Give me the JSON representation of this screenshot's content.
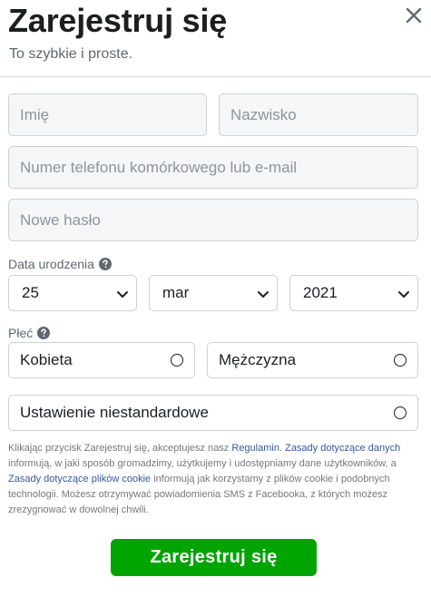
{
  "header": {
    "title": "Zarejestruj się",
    "subtitle": "To szybkie i proste."
  },
  "form": {
    "first_name_placeholder": "Imię",
    "last_name_placeholder": "Nazwisko",
    "contact_placeholder": "Numer telefonu komórkowego lub e-mail",
    "password_placeholder": "Nowe hasło"
  },
  "birthday": {
    "label": "Data urodzenia",
    "day": "25",
    "month": "mar",
    "year": "2021"
  },
  "gender": {
    "label": "Płeć",
    "female": "Kobieta",
    "male": "Mężczyzna",
    "custom": "Ustawienie niestandardowe"
  },
  "terms": {
    "part1": "Klikając przycisk Zarejestruj się, akceptujesz nasz ",
    "link_terms": "Regulamin",
    "part2": ". ",
    "link_data_policy": "Zasady dotyczące danych",
    "part3": " informują, w jaki sposób gromadzimy, użytkujemy i udostępniamy dane użytkowników, a ",
    "link_cookies": "Zasady dotyczące plików cookie",
    "part4": " informują jak korzystamy z plików cookie i podobnych technologii. Możesz otrzymywać powiadomienia SMS z Facebooka, z których możesz zrezygnować w dowolnej chwili."
  },
  "submit_label": "Zarejestruj się",
  "colors": {
    "submit_green": "#00a400",
    "link_blue": "#385898",
    "input_bg": "#f5f6f7"
  },
  "icons": {
    "close": "close-icon",
    "help": "question-circle-icon",
    "dropdown": "chevron-down-icon"
  }
}
